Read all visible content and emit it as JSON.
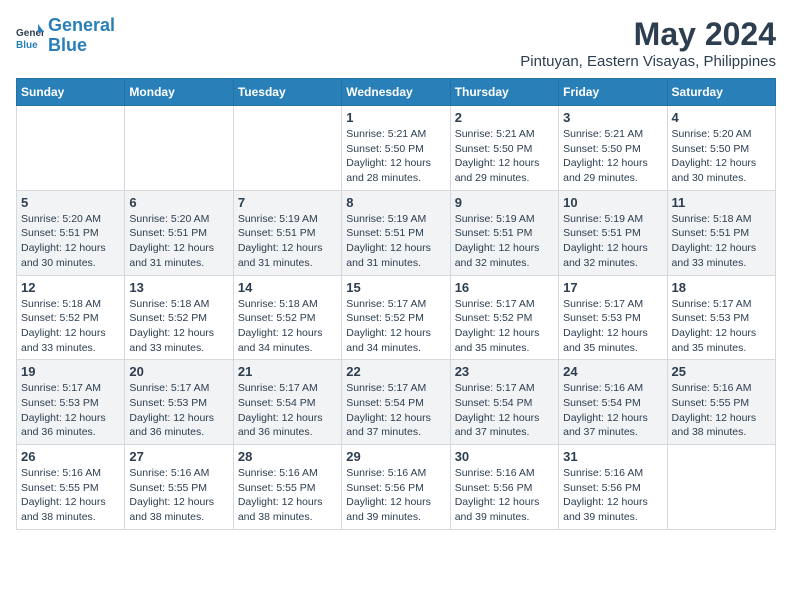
{
  "logo": {
    "line1": "General",
    "line2": "Blue"
  },
  "title": "May 2024",
  "subtitle": "Pintuyan, Eastern Visayas, Philippines",
  "days_of_week": [
    "Sunday",
    "Monday",
    "Tuesday",
    "Wednesday",
    "Thursday",
    "Friday",
    "Saturday"
  ],
  "weeks": [
    [
      {
        "day": "",
        "sunrise": "",
        "sunset": "",
        "daylight": ""
      },
      {
        "day": "",
        "sunrise": "",
        "sunset": "",
        "daylight": ""
      },
      {
        "day": "",
        "sunrise": "",
        "sunset": "",
        "daylight": ""
      },
      {
        "day": "1",
        "sunrise": "Sunrise: 5:21 AM",
        "sunset": "Sunset: 5:50 PM",
        "daylight": "Daylight: 12 hours and 28 minutes."
      },
      {
        "day": "2",
        "sunrise": "Sunrise: 5:21 AM",
        "sunset": "Sunset: 5:50 PM",
        "daylight": "Daylight: 12 hours and 29 minutes."
      },
      {
        "day": "3",
        "sunrise": "Sunrise: 5:21 AM",
        "sunset": "Sunset: 5:50 PM",
        "daylight": "Daylight: 12 hours and 29 minutes."
      },
      {
        "day": "4",
        "sunrise": "Sunrise: 5:20 AM",
        "sunset": "Sunset: 5:50 PM",
        "daylight": "Daylight: 12 hours and 30 minutes."
      }
    ],
    [
      {
        "day": "5",
        "sunrise": "Sunrise: 5:20 AM",
        "sunset": "Sunset: 5:51 PM",
        "daylight": "Daylight: 12 hours and 30 minutes."
      },
      {
        "day": "6",
        "sunrise": "Sunrise: 5:20 AM",
        "sunset": "Sunset: 5:51 PM",
        "daylight": "Daylight: 12 hours and 31 minutes."
      },
      {
        "day": "7",
        "sunrise": "Sunrise: 5:19 AM",
        "sunset": "Sunset: 5:51 PM",
        "daylight": "Daylight: 12 hours and 31 minutes."
      },
      {
        "day": "8",
        "sunrise": "Sunrise: 5:19 AM",
        "sunset": "Sunset: 5:51 PM",
        "daylight": "Daylight: 12 hours and 31 minutes."
      },
      {
        "day": "9",
        "sunrise": "Sunrise: 5:19 AM",
        "sunset": "Sunset: 5:51 PM",
        "daylight": "Daylight: 12 hours and 32 minutes."
      },
      {
        "day": "10",
        "sunrise": "Sunrise: 5:19 AM",
        "sunset": "Sunset: 5:51 PM",
        "daylight": "Daylight: 12 hours and 32 minutes."
      },
      {
        "day": "11",
        "sunrise": "Sunrise: 5:18 AM",
        "sunset": "Sunset: 5:51 PM",
        "daylight": "Daylight: 12 hours and 33 minutes."
      }
    ],
    [
      {
        "day": "12",
        "sunrise": "Sunrise: 5:18 AM",
        "sunset": "Sunset: 5:52 PM",
        "daylight": "Daylight: 12 hours and 33 minutes."
      },
      {
        "day": "13",
        "sunrise": "Sunrise: 5:18 AM",
        "sunset": "Sunset: 5:52 PM",
        "daylight": "Daylight: 12 hours and 33 minutes."
      },
      {
        "day": "14",
        "sunrise": "Sunrise: 5:18 AM",
        "sunset": "Sunset: 5:52 PM",
        "daylight": "Daylight: 12 hours and 34 minutes."
      },
      {
        "day": "15",
        "sunrise": "Sunrise: 5:17 AM",
        "sunset": "Sunset: 5:52 PM",
        "daylight": "Daylight: 12 hours and 34 minutes."
      },
      {
        "day": "16",
        "sunrise": "Sunrise: 5:17 AM",
        "sunset": "Sunset: 5:52 PM",
        "daylight": "Daylight: 12 hours and 35 minutes."
      },
      {
        "day": "17",
        "sunrise": "Sunrise: 5:17 AM",
        "sunset": "Sunset: 5:53 PM",
        "daylight": "Daylight: 12 hours and 35 minutes."
      },
      {
        "day": "18",
        "sunrise": "Sunrise: 5:17 AM",
        "sunset": "Sunset: 5:53 PM",
        "daylight": "Daylight: 12 hours and 35 minutes."
      }
    ],
    [
      {
        "day": "19",
        "sunrise": "Sunrise: 5:17 AM",
        "sunset": "Sunset: 5:53 PM",
        "daylight": "Daylight: 12 hours and 36 minutes."
      },
      {
        "day": "20",
        "sunrise": "Sunrise: 5:17 AM",
        "sunset": "Sunset: 5:53 PM",
        "daylight": "Daylight: 12 hours and 36 minutes."
      },
      {
        "day": "21",
        "sunrise": "Sunrise: 5:17 AM",
        "sunset": "Sunset: 5:54 PM",
        "daylight": "Daylight: 12 hours and 36 minutes."
      },
      {
        "day": "22",
        "sunrise": "Sunrise: 5:17 AM",
        "sunset": "Sunset: 5:54 PM",
        "daylight": "Daylight: 12 hours and 37 minutes."
      },
      {
        "day": "23",
        "sunrise": "Sunrise: 5:17 AM",
        "sunset": "Sunset: 5:54 PM",
        "daylight": "Daylight: 12 hours and 37 minutes."
      },
      {
        "day": "24",
        "sunrise": "Sunrise: 5:16 AM",
        "sunset": "Sunset: 5:54 PM",
        "daylight": "Daylight: 12 hours and 37 minutes."
      },
      {
        "day": "25",
        "sunrise": "Sunrise: 5:16 AM",
        "sunset": "Sunset: 5:55 PM",
        "daylight": "Daylight: 12 hours and 38 minutes."
      }
    ],
    [
      {
        "day": "26",
        "sunrise": "Sunrise: 5:16 AM",
        "sunset": "Sunset: 5:55 PM",
        "daylight": "Daylight: 12 hours and 38 minutes."
      },
      {
        "day": "27",
        "sunrise": "Sunrise: 5:16 AM",
        "sunset": "Sunset: 5:55 PM",
        "daylight": "Daylight: 12 hours and 38 minutes."
      },
      {
        "day": "28",
        "sunrise": "Sunrise: 5:16 AM",
        "sunset": "Sunset: 5:55 PM",
        "daylight": "Daylight: 12 hours and 38 minutes."
      },
      {
        "day": "29",
        "sunrise": "Sunrise: 5:16 AM",
        "sunset": "Sunset: 5:56 PM",
        "daylight": "Daylight: 12 hours and 39 minutes."
      },
      {
        "day": "30",
        "sunrise": "Sunrise: 5:16 AM",
        "sunset": "Sunset: 5:56 PM",
        "daylight": "Daylight: 12 hours and 39 minutes."
      },
      {
        "day": "31",
        "sunrise": "Sunrise: 5:16 AM",
        "sunset": "Sunset: 5:56 PM",
        "daylight": "Daylight: 12 hours and 39 minutes."
      },
      {
        "day": "",
        "sunrise": "",
        "sunset": "",
        "daylight": ""
      }
    ]
  ]
}
